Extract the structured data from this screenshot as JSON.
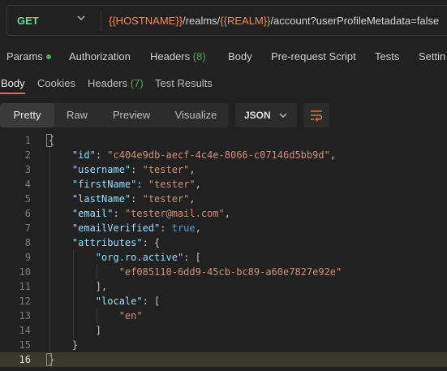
{
  "request": {
    "method": "GET",
    "url_parts": [
      {
        "text": "{{HOSTNAME}}",
        "var": true
      },
      {
        "text": "/realms/",
        "var": false
      },
      {
        "text": "{{REALM}}",
        "var": true
      },
      {
        "text": "/account?userProfileMetadata=false",
        "var": false
      }
    ]
  },
  "request_tabs": [
    {
      "label": "Params",
      "indicator": "dot"
    },
    {
      "label": "Authorization"
    },
    {
      "label": "Headers",
      "count": "(8)"
    },
    {
      "label": "Body"
    },
    {
      "label": "Pre-request Script"
    },
    {
      "label": "Tests"
    },
    {
      "label": "Settin"
    }
  ],
  "response_tabs": [
    {
      "label": "Body",
      "active": true
    },
    {
      "label": "Cookies"
    },
    {
      "label": "Headers",
      "count": "(7)"
    },
    {
      "label": "Test Results"
    }
  ],
  "format": {
    "modes": [
      "Pretty",
      "Raw",
      "Preview",
      "Visualize"
    ],
    "active_mode": "Pretty",
    "language": "JSON",
    "wrap_icon": "wrap-lines-icon"
  },
  "code_lines": [
    [
      {
        "t": "{",
        "c": ""
      }
    ],
    [
      {
        "t": "    ",
        "c": ""
      },
      {
        "t": "\"id\"",
        "c": "k"
      },
      {
        "t": ": ",
        "c": ""
      },
      {
        "t": "\"c404e9db-aecf-4c4e-8066-c07146d5bb9d\"",
        "c": "s"
      },
      {
        "t": ",",
        "c": ""
      }
    ],
    [
      {
        "t": "    ",
        "c": ""
      },
      {
        "t": "\"username\"",
        "c": "k"
      },
      {
        "t": ": ",
        "c": ""
      },
      {
        "t": "\"tester\"",
        "c": "s"
      },
      {
        "t": ",",
        "c": ""
      }
    ],
    [
      {
        "t": "    ",
        "c": ""
      },
      {
        "t": "\"firstName\"",
        "c": "k"
      },
      {
        "t": ": ",
        "c": ""
      },
      {
        "t": "\"tester\"",
        "c": "s"
      },
      {
        "t": ",",
        "c": ""
      }
    ],
    [
      {
        "t": "    ",
        "c": ""
      },
      {
        "t": "\"lastName\"",
        "c": "k"
      },
      {
        "t": ": ",
        "c": ""
      },
      {
        "t": "\"tester\"",
        "c": "s"
      },
      {
        "t": ",",
        "c": ""
      }
    ],
    [
      {
        "t": "    ",
        "c": ""
      },
      {
        "t": "\"email\"",
        "c": "k"
      },
      {
        "t": ": ",
        "c": ""
      },
      {
        "t": "\"tester@mail.com\"",
        "c": "s"
      },
      {
        "t": ",",
        "c": ""
      }
    ],
    [
      {
        "t": "    ",
        "c": ""
      },
      {
        "t": "\"emailVerified\"",
        "c": "k"
      },
      {
        "t": ": ",
        "c": ""
      },
      {
        "t": "true",
        "c": "b"
      },
      {
        "t": ",",
        "c": ""
      }
    ],
    [
      {
        "t": "    ",
        "c": ""
      },
      {
        "t": "\"attributes\"",
        "c": "k"
      },
      {
        "t": ": {",
        "c": ""
      }
    ],
    [
      {
        "t": "        ",
        "c": ""
      },
      {
        "t": "\"org.ro.active\"",
        "c": "k"
      },
      {
        "t": ": [",
        "c": ""
      }
    ],
    [
      {
        "t": "            ",
        "c": ""
      },
      {
        "t": "\"ef085110-6dd9-45cb-bc89-a60e7827e92e\"",
        "c": "s"
      }
    ],
    [
      {
        "t": "        ],",
        "c": ""
      }
    ],
    [
      {
        "t": "        ",
        "c": ""
      },
      {
        "t": "\"locale\"",
        "c": "k"
      },
      {
        "t": ": [",
        "c": ""
      }
    ],
    [
      {
        "t": "            ",
        "c": ""
      },
      {
        "t": "\"en\"",
        "c": "s"
      }
    ],
    [
      {
        "t": "        ]",
        "c": ""
      }
    ],
    [
      {
        "t": "    }",
        "c": ""
      }
    ],
    [
      {
        "t": "}",
        "c": ""
      }
    ]
  ],
  "highlighted_line": 16
}
